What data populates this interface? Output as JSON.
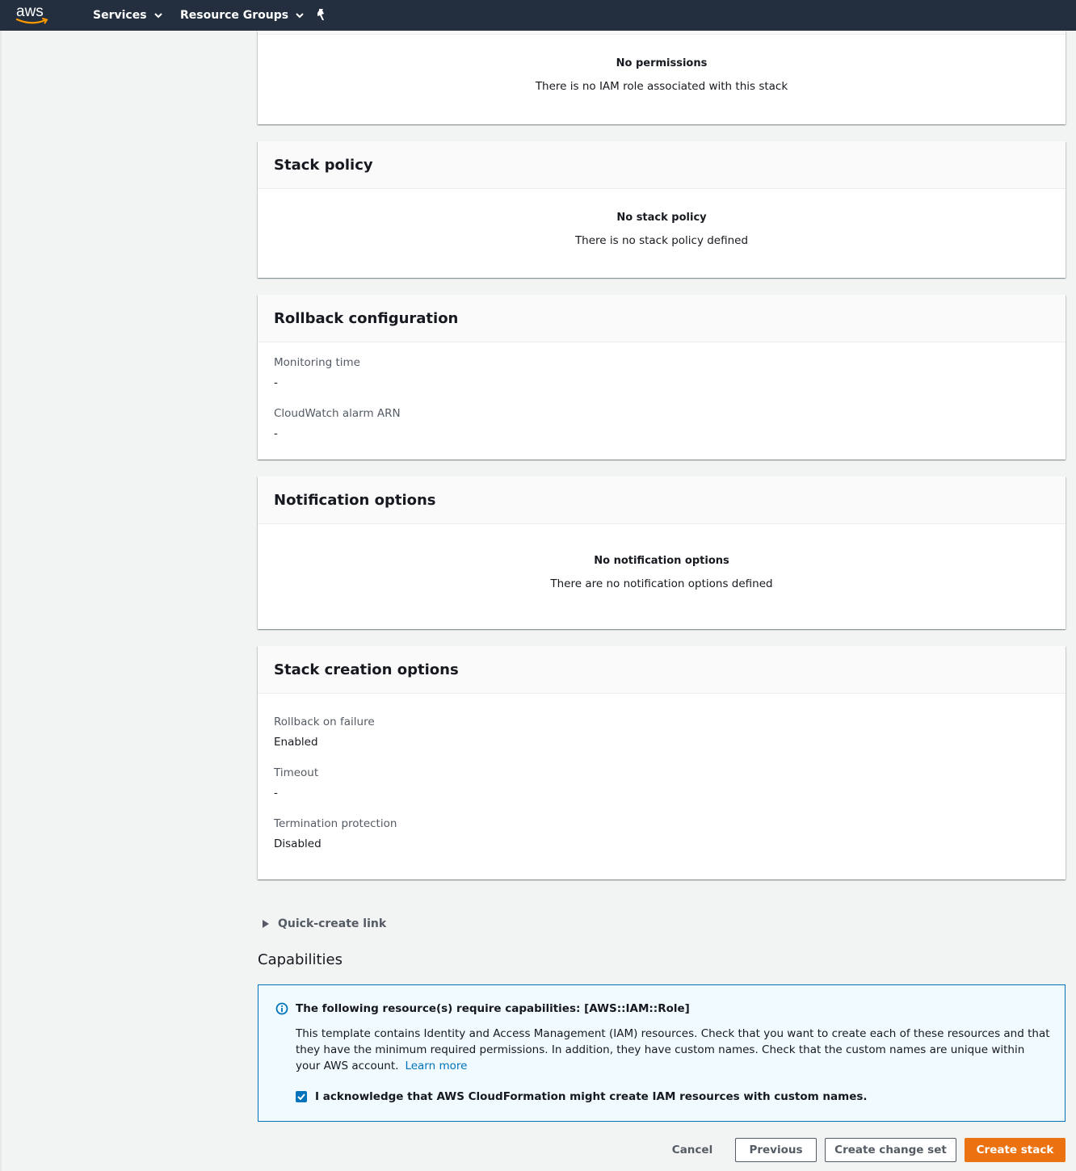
{
  "topbar": {
    "logo_text": "aws",
    "nav": [
      {
        "label": "Services"
      },
      {
        "label": "Resource Groups"
      }
    ]
  },
  "permissions": {
    "empty_title": "No permissions",
    "empty_desc": "There is no IAM role associated with this stack"
  },
  "stack_policy": {
    "title": "Stack policy",
    "empty_title": "No stack policy",
    "empty_desc": "There is no stack policy defined"
  },
  "rollback": {
    "title": "Rollback configuration",
    "fields": [
      {
        "label": "Monitoring time",
        "value": "-"
      },
      {
        "label": "CloudWatch alarm ARN",
        "value": "-"
      }
    ]
  },
  "notification": {
    "title": "Notification options",
    "empty_title": "No notification options",
    "empty_desc": "There are no notification options defined"
  },
  "creation_options": {
    "title": "Stack creation options",
    "fields": [
      {
        "label": "Rollback on failure",
        "value": "Enabled"
      },
      {
        "label": "Timeout",
        "value": "-"
      },
      {
        "label": "Termination protection",
        "value": "Disabled"
      }
    ]
  },
  "quick_create": {
    "label": "Quick-create link"
  },
  "capabilities": {
    "heading": "Capabilities",
    "alert_title": "The following resource(s) require capabilities: [AWS::IAM::Role]",
    "alert_body": "This template contains Identity and Access Management (IAM) resources. Check that you want to create each of these resources and that they have the minimum required permissions. In addition, they have custom names. Check that the custom names are unique within your AWS account.",
    "learn_more": "Learn more",
    "ack_label": "I acknowledge that AWS CloudFormation might create IAM resources with custom names.",
    "ack_checked": true
  },
  "actions": {
    "cancel": "Cancel",
    "previous": "Previous",
    "change_set": "Create change set",
    "create": "Create stack"
  },
  "colors": {
    "topbar": "#232f3e",
    "primary": "#ec7211",
    "link": "#0073bb"
  }
}
